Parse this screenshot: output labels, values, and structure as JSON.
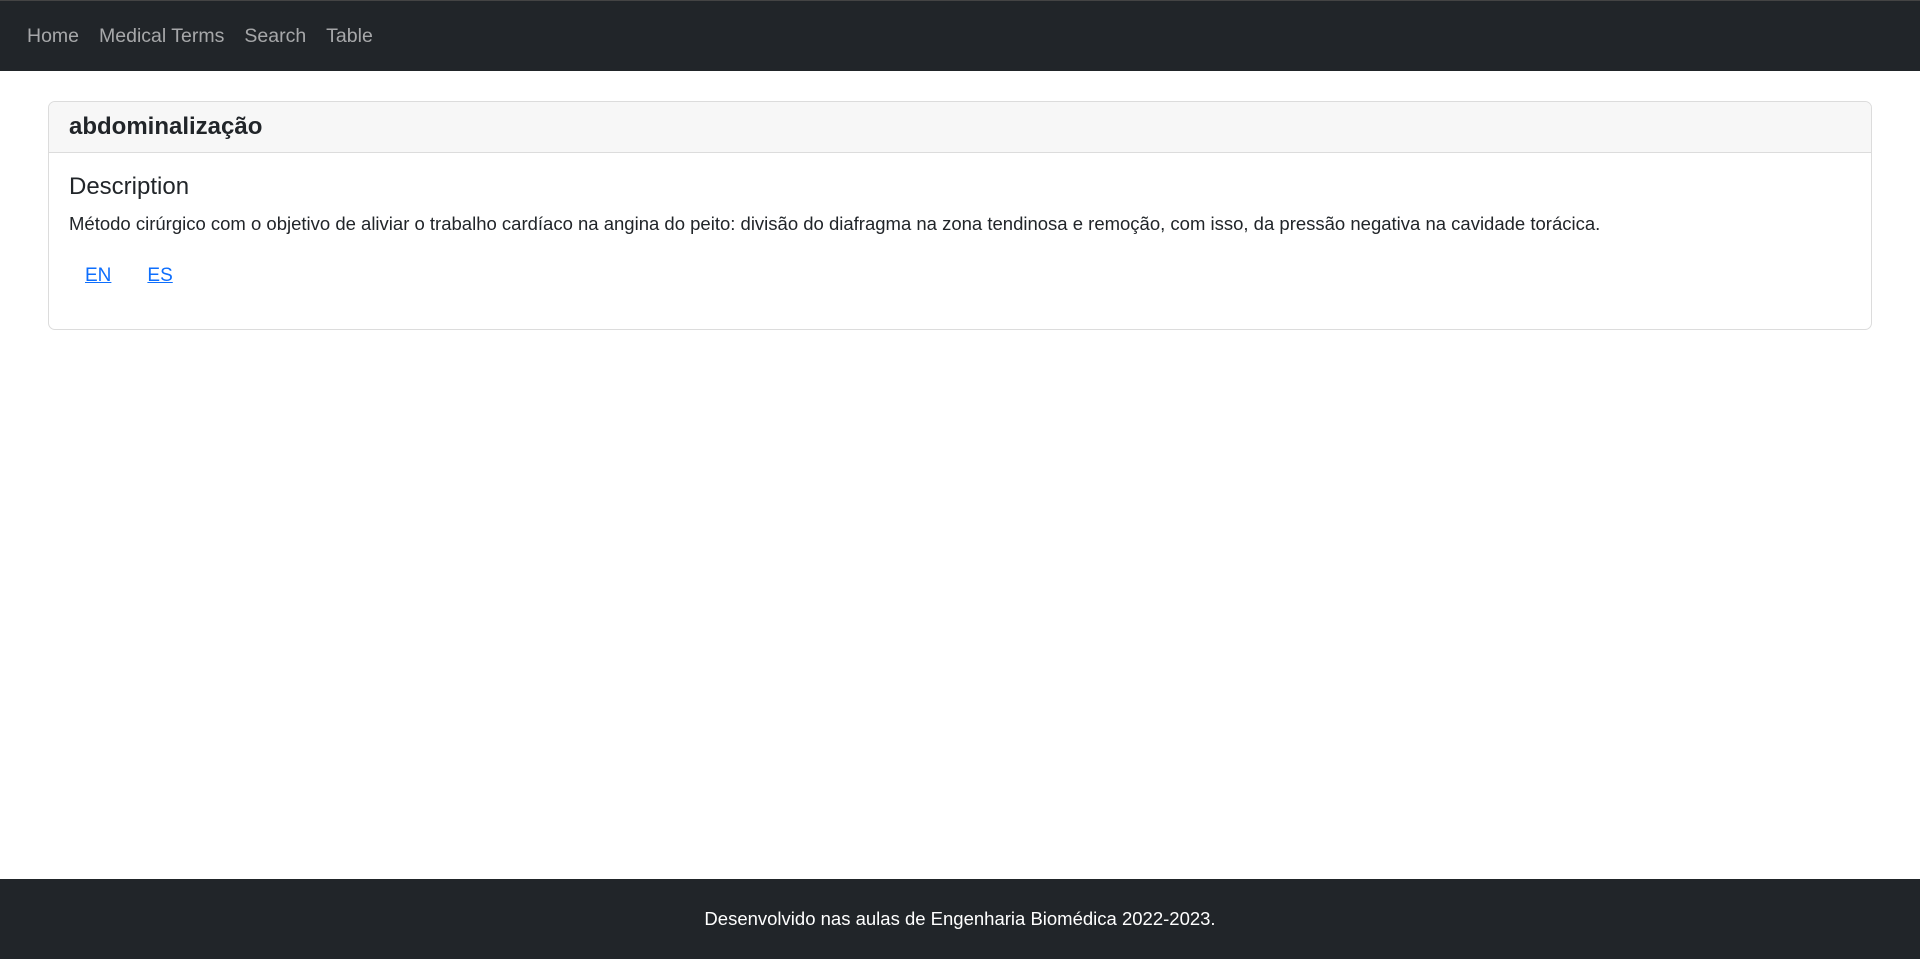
{
  "navbar": {
    "items": [
      {
        "label": "Home"
      },
      {
        "label": "Medical Terms"
      },
      {
        "label": "Search"
      },
      {
        "label": "Table"
      }
    ]
  },
  "term": {
    "title": "abdominalização",
    "description_heading": "Description",
    "description": "Método cirúrgico com o objetivo de aliviar o trabalho cardíaco na angina do peito: divisão do diafragma na zona tendinosa e remoção, com isso, da pressão negativa na cavidade torácica.",
    "languages": [
      {
        "label": "EN"
      },
      {
        "label": "ES"
      }
    ]
  },
  "footer": {
    "text": "Desenvolvido nas aulas de Engenharia Biomédica 2022-2023."
  },
  "colors": {
    "navbar_bg": "#212529",
    "link": "#0d6efd"
  }
}
